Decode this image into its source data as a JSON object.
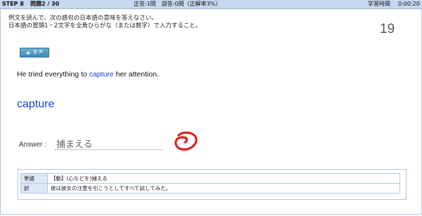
{
  "header": {
    "step": "STEP 8",
    "progress": "問題2 / 30",
    "score": "正答:1問　誤答:0問（正解率3%）",
    "time_label": "学習時間",
    "time_value": "0:00:20"
  },
  "instructions": {
    "line1": "例文を読んで、次の語句の日本語の意味を答えなさい。",
    "line2": "日本語の冒頭1・2文字を全角ひらがな（または数字）で入力すること。"
  },
  "question_number": "19",
  "audio_button": {
    "label": "音 声",
    "icon": "speaker-icon"
  },
  "sentence": {
    "before": "He tried everything to ",
    "highlight": "capture",
    "after": " her attention."
  },
  "target_word": "capture",
  "answer": {
    "label": "Answer :",
    "value": "捕まえる"
  },
  "result_mark": {
    "icon": "correct-circle-icon",
    "color": "#e02020"
  },
  "info": {
    "rows": [
      {
        "head": "単語",
        "body": "【動】(心などを)捕える"
      },
      {
        "head": "訳",
        "body": "彼は彼女の注意を引こうとしてすべて試してみた。"
      }
    ]
  },
  "colors": {
    "header_bg": "#c6d7f0",
    "accent_blue": "#1a3fcf",
    "audio_button": "#4a94c0"
  }
}
